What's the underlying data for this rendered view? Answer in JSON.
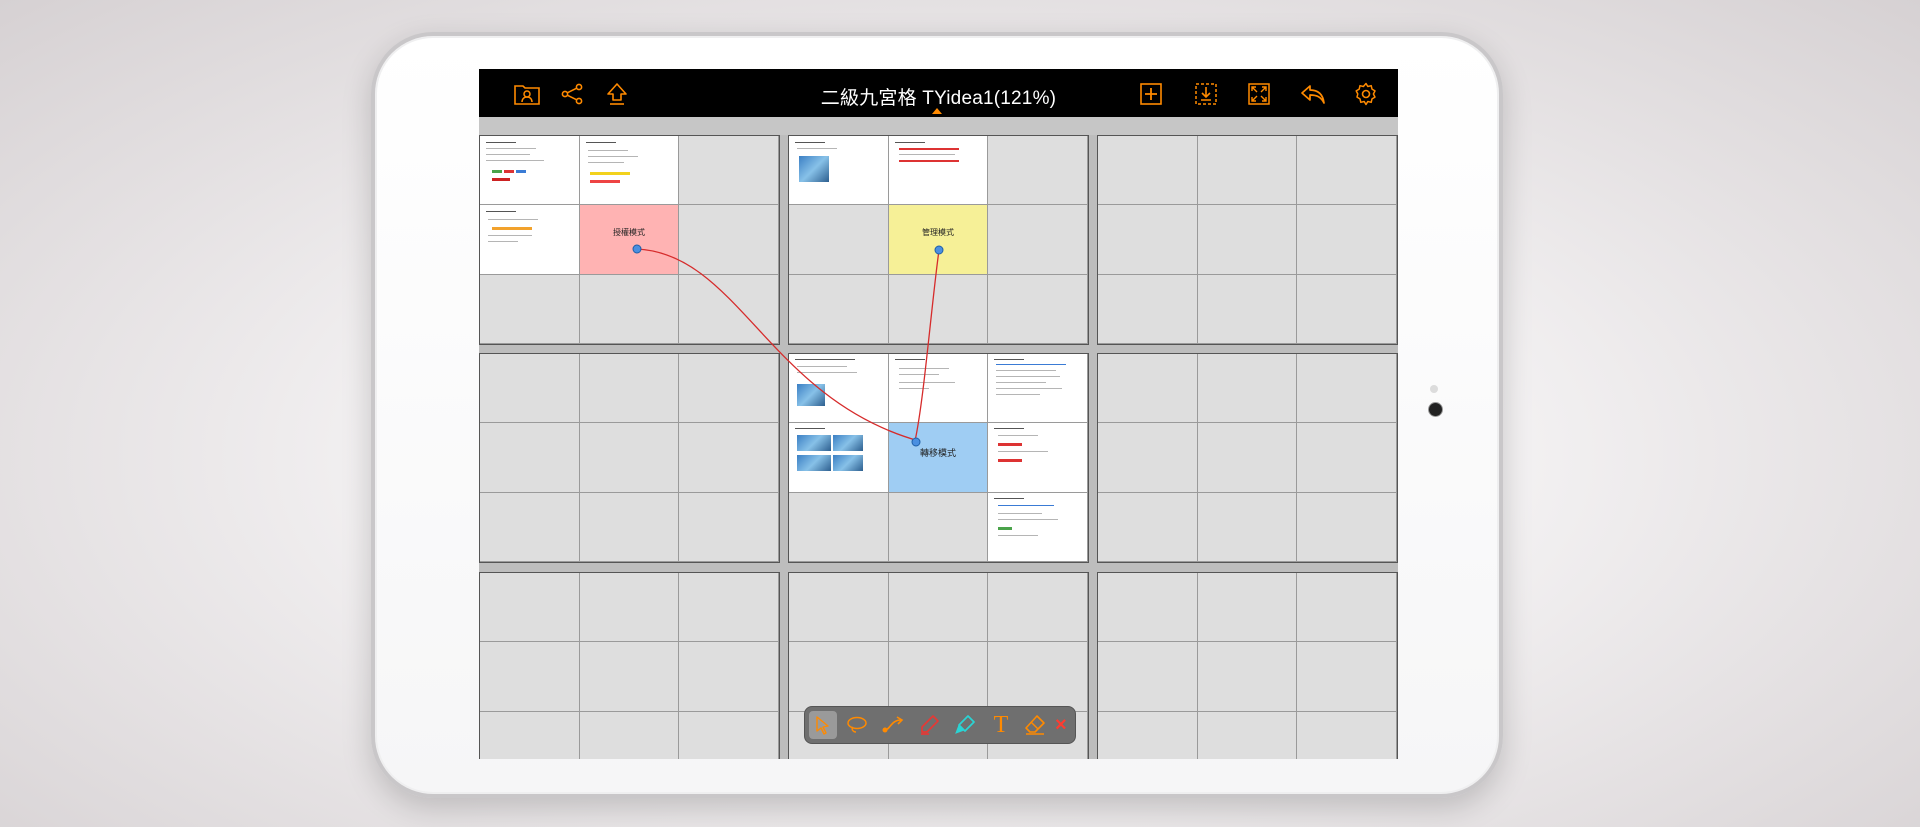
{
  "app": {
    "title": "二級九宮格 TYidea1(121%)"
  },
  "toolbar_top": {
    "left_icons": [
      "contacts-folder-icon",
      "share-icon",
      "upload-icon"
    ],
    "right_icons": [
      "add-icon",
      "export-icon",
      "fit-screen-icon",
      "undo-icon",
      "settings-icon"
    ]
  },
  "cards": {
    "authorization": "授權模式",
    "management": "管理模式",
    "transfer": "轉移模式"
  },
  "drawing_tools": {
    "items": [
      "select-pointer-icon",
      "lasso-icon",
      "connector-icon",
      "red-pen-icon",
      "highlighter-icon",
      "text-tool-icon",
      "eraser-icon",
      "close-icon"
    ],
    "active": "select-pointer-icon",
    "text_tool_glyph": "T",
    "close_glyph": "×"
  },
  "colors": {
    "accent": "#ff8a00",
    "pink_card": "#ffb3b3",
    "yellow_card": "#f6f097",
    "blue_card": "#9fcdf3",
    "connector": "#d62b2b",
    "close": "#ff3b30"
  }
}
